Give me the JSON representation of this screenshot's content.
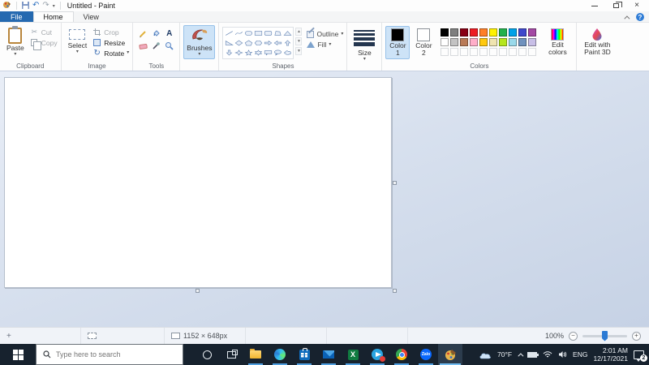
{
  "titlebar": {
    "title": "Untitled - Paint"
  },
  "glyphs": {
    "caret": "▾",
    "undo": "↶",
    "redo": "↷",
    "close": "×",
    "cut": "✂",
    "rotate": "↻",
    "crosshair": "+",
    "minus": "−",
    "plus": "+",
    "help": "?",
    "text_tool": "A",
    "excel": "X"
  },
  "tabs": {
    "file": "File",
    "home": "Home",
    "view": "View"
  },
  "ribbon": {
    "clipboard": {
      "paste": "Paste",
      "cut": "Cut",
      "copy": "Copy",
      "group": "Clipboard"
    },
    "image": {
      "select": "Select",
      "crop": "Crop",
      "resize": "Resize",
      "rotate": "Rotate",
      "group": "Image"
    },
    "tools": {
      "group": "Tools"
    },
    "brushes": {
      "label": "Brushes"
    },
    "shapes": {
      "group": "Shapes",
      "outline": "Outline",
      "fill": "Fill",
      "items": [
        "line",
        "curve",
        "oval",
        "rectangle",
        "rounded-rectangle",
        "polygon",
        "triangle",
        "right-triangle",
        "diamond",
        "pentagon",
        "hexagon",
        "right-arrow",
        "left-arrow",
        "up-arrow",
        "down-arrow",
        "four-point-star",
        "five-point-star",
        "six-point-star",
        "rounded-callout",
        "oval-callout",
        "cloud-callout"
      ]
    },
    "size": {
      "label": "Size"
    },
    "colors": {
      "group": "Colors",
      "color1": "Color 1",
      "color2": "Color 2",
      "color1_value": "#000000",
      "color2_value": "#ffffff",
      "edit_colors": "Edit colors",
      "edit_paint3d": "Edit with Paint 3D",
      "row1": [
        "#000000",
        "#7f7f7f",
        "#880015",
        "#ed1c24",
        "#ff7f27",
        "#fff200",
        "#22b14c",
        "#00a2e8",
        "#3f48cc",
        "#a349a4"
      ],
      "row2": [
        "#ffffff",
        "#c3c3c3",
        "#b97a57",
        "#ffaec9",
        "#ffc90e",
        "#efe4b0",
        "#b5e61d",
        "#99d9ea",
        "#7092be",
        "#c8bfe7"
      ],
      "empty_count": 10
    }
  },
  "statusbar": {
    "image_size": "1152 × 648px",
    "zoom_level": "100%"
  },
  "taskbar": {
    "search_placeholder": "Type here to search",
    "apps": [
      "cortana",
      "task-view",
      "file-explorer",
      "edge",
      "store",
      "mail",
      "excel",
      "telegram",
      "chrome",
      "zalo",
      "paint"
    ],
    "zalo_label": "Zalo",
    "tray": {
      "temperature": "70°F",
      "language": "ENG",
      "time": "2:01 AM",
      "date": "12/17/2021",
      "notification_count": "2"
    }
  }
}
